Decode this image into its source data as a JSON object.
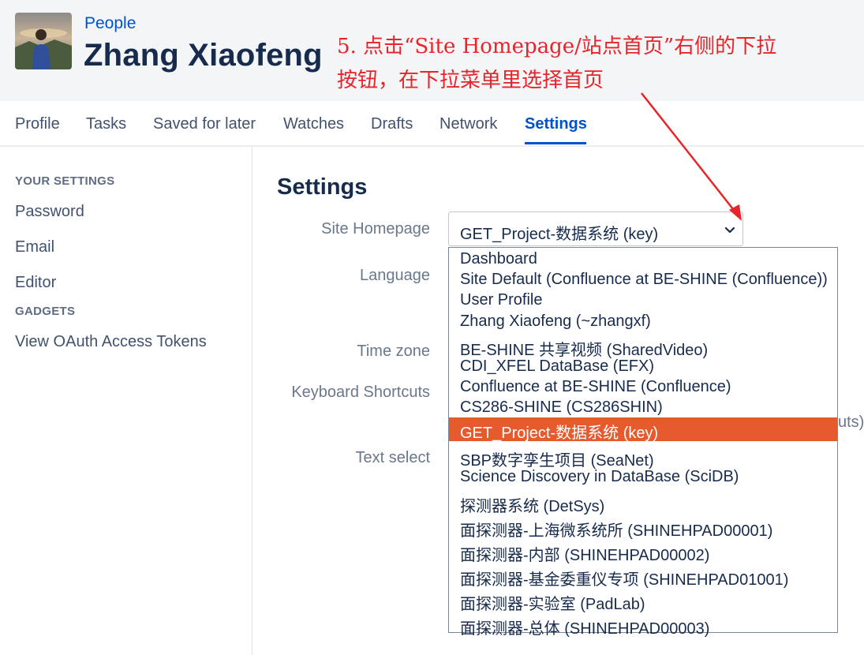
{
  "header": {
    "breadcrumb": "People",
    "title": "Zhang Xiaofeng"
  },
  "annotation": {
    "line1": "5. 点击“Site Homepage/站点首页”右侧的下拉",
    "line2": "按钮，在下拉菜单里选择首页",
    "color": "#e8242b"
  },
  "tabs": [
    {
      "label": "Profile"
    },
    {
      "label": "Tasks"
    },
    {
      "label": "Saved for later"
    },
    {
      "label": "Watches"
    },
    {
      "label": "Drafts"
    },
    {
      "label": "Network"
    },
    {
      "label": "Settings",
      "active": true
    }
  ],
  "sidebar": {
    "your_settings_heading": "YOUR SETTINGS",
    "your_settings": [
      "Password",
      "Email",
      "Editor"
    ],
    "gadgets_heading": "GADGETS",
    "gadgets": [
      "View OAuth Access Tokens"
    ]
  },
  "main": {
    "title": "Settings",
    "labels": {
      "site_homepage": "Site Homepage",
      "language": "Language",
      "time_zone": "Time zone",
      "keyboard_shortcuts": "Keyboard Shortcuts",
      "text_select": "Text select"
    },
    "clipped_text": "uts)",
    "site_homepage_select": {
      "value": "GET_Project-数据系统 (key)",
      "options": [
        "Dashboard",
        "Site Default (Confluence at BE-SHINE (Confluence))",
        "User Profile",
        "Zhang Xiaofeng (~zhangxf)",
        "BE-SHINE 共享视频 (SharedVideo)",
        "CDI_XFEL DataBase (EFX)",
        "Confluence at BE-SHINE (Confluence)",
        "CS286-SHINE (CS286SHIN)",
        "GET_Project-数据系统 (key)",
        "SBP数字孪生项目 (SeaNet)",
        "Science Discovery in DataBase (SciDB)",
        "探测器系统 (DetSys)",
        "面探测器-上海微系统所 (SHINEHPAD00001)",
        "面探测器-内部 (SHINEHPAD00002)",
        "面探测器-基金委重仪专项 (SHINEHPAD01001)",
        "面探测器-实验室 (PadLab)",
        "面探测器-总体 (SHINEHPAD00003)"
      ],
      "selected_index": 8,
      "highlight_color": "#e55b2d"
    }
  },
  "colors": {
    "link": "#0052cc",
    "header_bg": "#f4f5f7"
  }
}
